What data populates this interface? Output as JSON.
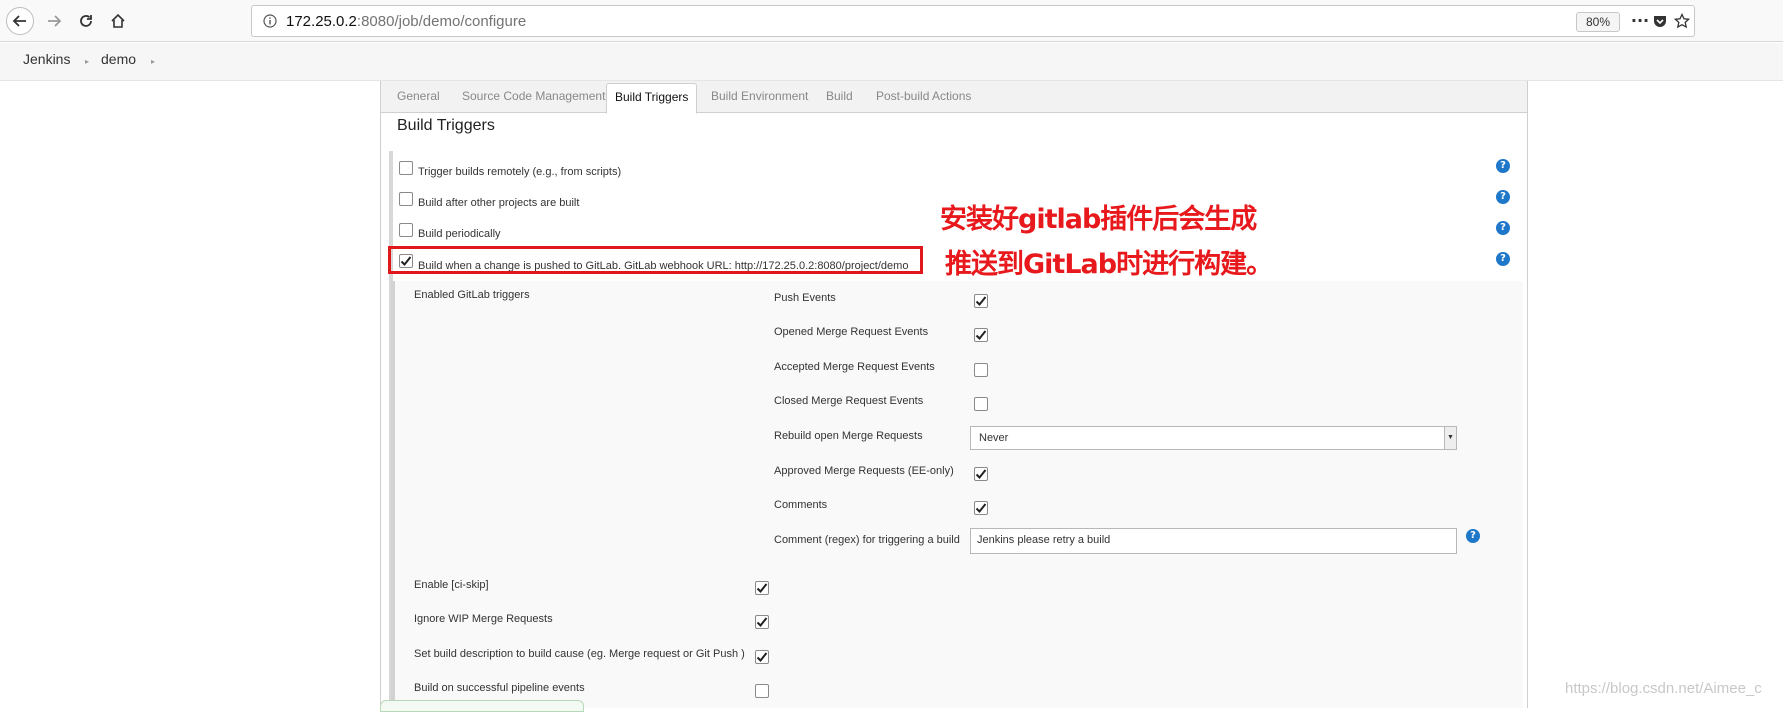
{
  "browser": {
    "url_host": "172.25.0.2",
    "url_rest": ":8080/job/demo/configure",
    "zoom": "80%"
  },
  "breadcrumb": {
    "items": [
      "Jenkins",
      "demo"
    ]
  },
  "tabs": [
    {
      "label": "General"
    },
    {
      "label": "Source Code Management"
    },
    {
      "label": "Build Triggers"
    },
    {
      "label": "Build Environment"
    },
    {
      "label": "Build"
    },
    {
      "label": "Post-build Actions"
    }
  ],
  "section": {
    "title": "Build Triggers"
  },
  "triggers": [
    {
      "label": "Trigger builds remotely (e.g., from scripts)",
      "checked": false
    },
    {
      "label": "Build after other projects are built",
      "checked": false
    },
    {
      "label": "Build periodically",
      "checked": false
    },
    {
      "label": "Build when a change is pushed to GitLab. GitLab webhook URL: http://172.25.0.2:8080/project/demo",
      "checked": true
    }
  ],
  "gitlab": {
    "enabled_label": "Enabled GitLab triggers",
    "options": [
      {
        "label": "Push Events",
        "checked": true
      },
      {
        "label": "Opened Merge Request Events",
        "checked": true
      },
      {
        "label": "Accepted Merge Request Events",
        "checked": false
      },
      {
        "label": "Closed Merge Request Events",
        "checked": false
      }
    ],
    "rebuild_label": "Rebuild open Merge Requests",
    "rebuild_value": "Never",
    "options2": [
      {
        "label": "Approved Merge Requests (EE-only)",
        "checked": true
      },
      {
        "label": "Comments",
        "checked": true
      }
    ],
    "comment_label": "Comment (regex) for triggering a build",
    "comment_value": "Jenkins please retry a build"
  },
  "extra_options": [
    {
      "label": "Enable [ci-skip]",
      "checked": true
    },
    {
      "label": "Ignore WIP Merge Requests",
      "checked": true
    },
    {
      "label": "Set build description to build cause (eg. Merge request or Git Push )",
      "checked": true
    },
    {
      "label": "Build on successful pipeline events",
      "checked": false
    }
  ],
  "annotation": {
    "line1": "安装好gitlab插件后会生成",
    "line2": "推送到GitLab时进行构建。"
  },
  "watermark": "https://blog.csdn.net/Aimee_c",
  "colors": {
    "annotation": "#e8191c",
    "help": "#1f77c9"
  }
}
